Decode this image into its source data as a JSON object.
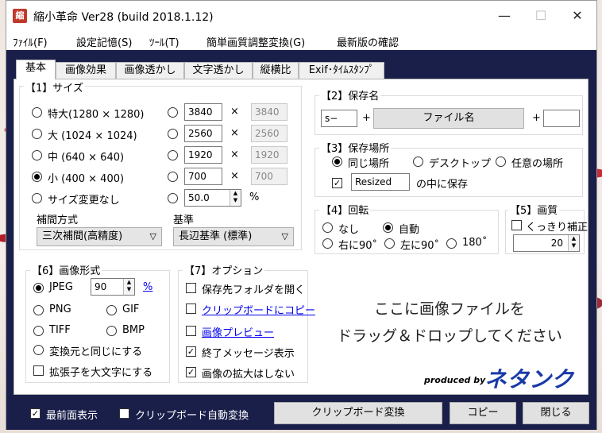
{
  "window": {
    "icon_text": "縮",
    "title": "縮小革命 Ver28 (build 2018.1.12)",
    "minimize_glyph": "—",
    "maximize_glyph": "☐",
    "close_glyph": "✕"
  },
  "menu": [
    "ﾌｧｲﾙ(F)",
    "設定記憶(S)",
    "ﾂｰﾙ(T)",
    "簡単画質調整変換(G)",
    "最新版の確認"
  ],
  "tabs": [
    "基本",
    "画像効果",
    "画像透かし",
    "文字透かし",
    "縦横比",
    "Exif･ﾀｲﾑｽﾀﾝﾌﾟ"
  ],
  "size": {
    "title": "【1】サイズ",
    "presets": [
      "特大(1280 × 1280)",
      "大 (1024 × 1024)",
      "中 (640 × 640)",
      "小 (400 × 400)",
      "サイズ変更なし"
    ],
    "selected_preset": "小 (400 × 400)",
    "custom_w": [
      "3840",
      "2560",
      "1920",
      "700"
    ],
    "custom_h": [
      "3840",
      "2560",
      "1920",
      "700"
    ],
    "times": "×",
    "percent_value": "50.0",
    "percent_sign": "%",
    "interp_label": "補間方式",
    "interp_value": "三次補間(高精度)",
    "basis_label": "基準",
    "basis_value": "長辺基準 (標準)"
  },
  "save_name": {
    "title": "【2】保存名",
    "prefix": "s−",
    "plus": "+",
    "button": "ファイル名",
    "suffix": ""
  },
  "save_place": {
    "title": "【3】保存場所",
    "options": [
      "同じ場所",
      "デスクトップ",
      "任意の場所"
    ],
    "selected": "同じ場所",
    "folder": "Resized",
    "folder_suffix": "の中に保存"
  },
  "rotate": {
    "title": "【4】回転",
    "options": [
      "なし",
      "自動",
      "右に90˚",
      "左に90˚",
      "180˚"
    ],
    "selected": "自動"
  },
  "quality": {
    "title": "【5】画質",
    "sharpen": "くっきり補正",
    "value": "20"
  },
  "format": {
    "title": "【6】画像形式",
    "jpeg": "JPEG",
    "jpeg_quality": "90",
    "percent_link": "%",
    "png": "PNG",
    "gif": "GIF",
    "tiff": "TIFF",
    "bmp": "BMP",
    "same": "変換元と同じにする",
    "upper_ext": "拡張子を大文字にする",
    "selected": "JPEG"
  },
  "options": {
    "title": "【7】オプション",
    "open_folder": "保存先フォルダを開く",
    "copy_clipboard": "クリップボードにコピー",
    "preview": "画像プレビュー",
    "end_message": "終了メッセージ表示",
    "no_enlarge": "画像の拡大はしない"
  },
  "drop": {
    "line1": "ここに画像ファイルを",
    "line2": "ドラッグ＆ドロップしてください",
    "produced": "produced by",
    "brand": "ネタンク"
  },
  "footer": {
    "topmost": "最前面表示",
    "auto_clip": "クリップボード自動変換",
    "clip_convert": "クリップボード変換",
    "copy": "コピー",
    "close": "閉じる"
  },
  "colors": {
    "frame": "#1a1f4a",
    "brand": "#1a3aa8",
    "link": "#0000ee"
  }
}
